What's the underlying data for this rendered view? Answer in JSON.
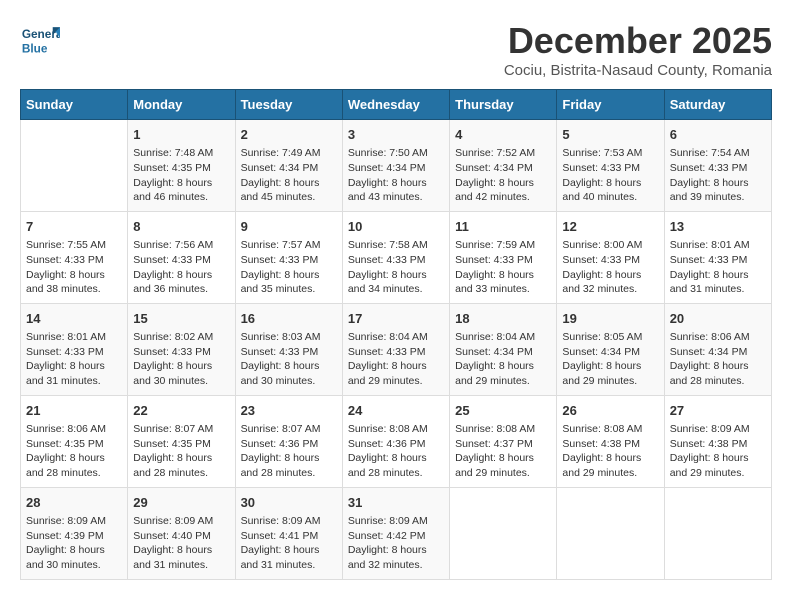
{
  "header": {
    "logo_text_general": "General",
    "logo_text_blue": "Blue",
    "month": "December 2025",
    "location": "Cociu, Bistrita-Nasaud County, Romania"
  },
  "calendar": {
    "days_of_week": [
      "Sunday",
      "Monday",
      "Tuesday",
      "Wednesday",
      "Thursday",
      "Friday",
      "Saturday"
    ],
    "weeks": [
      [
        {
          "day": "",
          "sunrise": "",
          "sunset": "",
          "daylight": ""
        },
        {
          "day": "1",
          "sunrise": "Sunrise: 7:48 AM",
          "sunset": "Sunset: 4:35 PM",
          "daylight": "Daylight: 8 hours and 46 minutes."
        },
        {
          "day": "2",
          "sunrise": "Sunrise: 7:49 AM",
          "sunset": "Sunset: 4:34 PM",
          "daylight": "Daylight: 8 hours and 45 minutes."
        },
        {
          "day": "3",
          "sunrise": "Sunrise: 7:50 AM",
          "sunset": "Sunset: 4:34 PM",
          "daylight": "Daylight: 8 hours and 43 minutes."
        },
        {
          "day": "4",
          "sunrise": "Sunrise: 7:52 AM",
          "sunset": "Sunset: 4:34 PM",
          "daylight": "Daylight: 8 hours and 42 minutes."
        },
        {
          "day": "5",
          "sunrise": "Sunrise: 7:53 AM",
          "sunset": "Sunset: 4:33 PM",
          "daylight": "Daylight: 8 hours and 40 minutes."
        },
        {
          "day": "6",
          "sunrise": "Sunrise: 7:54 AM",
          "sunset": "Sunset: 4:33 PM",
          "daylight": "Daylight: 8 hours and 39 minutes."
        }
      ],
      [
        {
          "day": "7",
          "sunrise": "Sunrise: 7:55 AM",
          "sunset": "Sunset: 4:33 PM",
          "daylight": "Daylight: 8 hours and 38 minutes."
        },
        {
          "day": "8",
          "sunrise": "Sunrise: 7:56 AM",
          "sunset": "Sunset: 4:33 PM",
          "daylight": "Daylight: 8 hours and 36 minutes."
        },
        {
          "day": "9",
          "sunrise": "Sunrise: 7:57 AM",
          "sunset": "Sunset: 4:33 PM",
          "daylight": "Daylight: 8 hours and 35 minutes."
        },
        {
          "day": "10",
          "sunrise": "Sunrise: 7:58 AM",
          "sunset": "Sunset: 4:33 PM",
          "daylight": "Daylight: 8 hours and 34 minutes."
        },
        {
          "day": "11",
          "sunrise": "Sunrise: 7:59 AM",
          "sunset": "Sunset: 4:33 PM",
          "daylight": "Daylight: 8 hours and 33 minutes."
        },
        {
          "day": "12",
          "sunrise": "Sunrise: 8:00 AM",
          "sunset": "Sunset: 4:33 PM",
          "daylight": "Daylight: 8 hours and 32 minutes."
        },
        {
          "day": "13",
          "sunrise": "Sunrise: 8:01 AM",
          "sunset": "Sunset: 4:33 PM",
          "daylight": "Daylight: 8 hours and 31 minutes."
        }
      ],
      [
        {
          "day": "14",
          "sunrise": "Sunrise: 8:01 AM",
          "sunset": "Sunset: 4:33 PM",
          "daylight": "Daylight: 8 hours and 31 minutes."
        },
        {
          "day": "15",
          "sunrise": "Sunrise: 8:02 AM",
          "sunset": "Sunset: 4:33 PM",
          "daylight": "Daylight: 8 hours and 30 minutes."
        },
        {
          "day": "16",
          "sunrise": "Sunrise: 8:03 AM",
          "sunset": "Sunset: 4:33 PM",
          "daylight": "Daylight: 8 hours and 30 minutes."
        },
        {
          "day": "17",
          "sunrise": "Sunrise: 8:04 AM",
          "sunset": "Sunset: 4:33 PM",
          "daylight": "Daylight: 8 hours and 29 minutes."
        },
        {
          "day": "18",
          "sunrise": "Sunrise: 8:04 AM",
          "sunset": "Sunset: 4:34 PM",
          "daylight": "Daylight: 8 hours and 29 minutes."
        },
        {
          "day": "19",
          "sunrise": "Sunrise: 8:05 AM",
          "sunset": "Sunset: 4:34 PM",
          "daylight": "Daylight: 8 hours and 29 minutes."
        },
        {
          "day": "20",
          "sunrise": "Sunrise: 8:06 AM",
          "sunset": "Sunset: 4:34 PM",
          "daylight": "Daylight: 8 hours and 28 minutes."
        }
      ],
      [
        {
          "day": "21",
          "sunrise": "Sunrise: 8:06 AM",
          "sunset": "Sunset: 4:35 PM",
          "daylight": "Daylight: 8 hours and 28 minutes."
        },
        {
          "day": "22",
          "sunrise": "Sunrise: 8:07 AM",
          "sunset": "Sunset: 4:35 PM",
          "daylight": "Daylight: 8 hours and 28 minutes."
        },
        {
          "day": "23",
          "sunrise": "Sunrise: 8:07 AM",
          "sunset": "Sunset: 4:36 PM",
          "daylight": "Daylight: 8 hours and 28 minutes."
        },
        {
          "day": "24",
          "sunrise": "Sunrise: 8:08 AM",
          "sunset": "Sunset: 4:36 PM",
          "daylight": "Daylight: 8 hours and 28 minutes."
        },
        {
          "day": "25",
          "sunrise": "Sunrise: 8:08 AM",
          "sunset": "Sunset: 4:37 PM",
          "daylight": "Daylight: 8 hours and 29 minutes."
        },
        {
          "day": "26",
          "sunrise": "Sunrise: 8:08 AM",
          "sunset": "Sunset: 4:38 PM",
          "daylight": "Daylight: 8 hours and 29 minutes."
        },
        {
          "day": "27",
          "sunrise": "Sunrise: 8:09 AM",
          "sunset": "Sunset: 4:38 PM",
          "daylight": "Daylight: 8 hours and 29 minutes."
        }
      ],
      [
        {
          "day": "28",
          "sunrise": "Sunrise: 8:09 AM",
          "sunset": "Sunset: 4:39 PM",
          "daylight": "Daylight: 8 hours and 30 minutes."
        },
        {
          "day": "29",
          "sunrise": "Sunrise: 8:09 AM",
          "sunset": "Sunset: 4:40 PM",
          "daylight": "Daylight: 8 hours and 31 minutes."
        },
        {
          "day": "30",
          "sunrise": "Sunrise: 8:09 AM",
          "sunset": "Sunset: 4:41 PM",
          "daylight": "Daylight: 8 hours and 31 minutes."
        },
        {
          "day": "31",
          "sunrise": "Sunrise: 8:09 AM",
          "sunset": "Sunset: 4:42 PM",
          "daylight": "Daylight: 8 hours and 32 minutes."
        },
        {
          "day": "",
          "sunrise": "",
          "sunset": "",
          "daylight": ""
        },
        {
          "day": "",
          "sunrise": "",
          "sunset": "",
          "daylight": ""
        },
        {
          "day": "",
          "sunrise": "",
          "sunset": "",
          "daylight": ""
        }
      ]
    ]
  }
}
